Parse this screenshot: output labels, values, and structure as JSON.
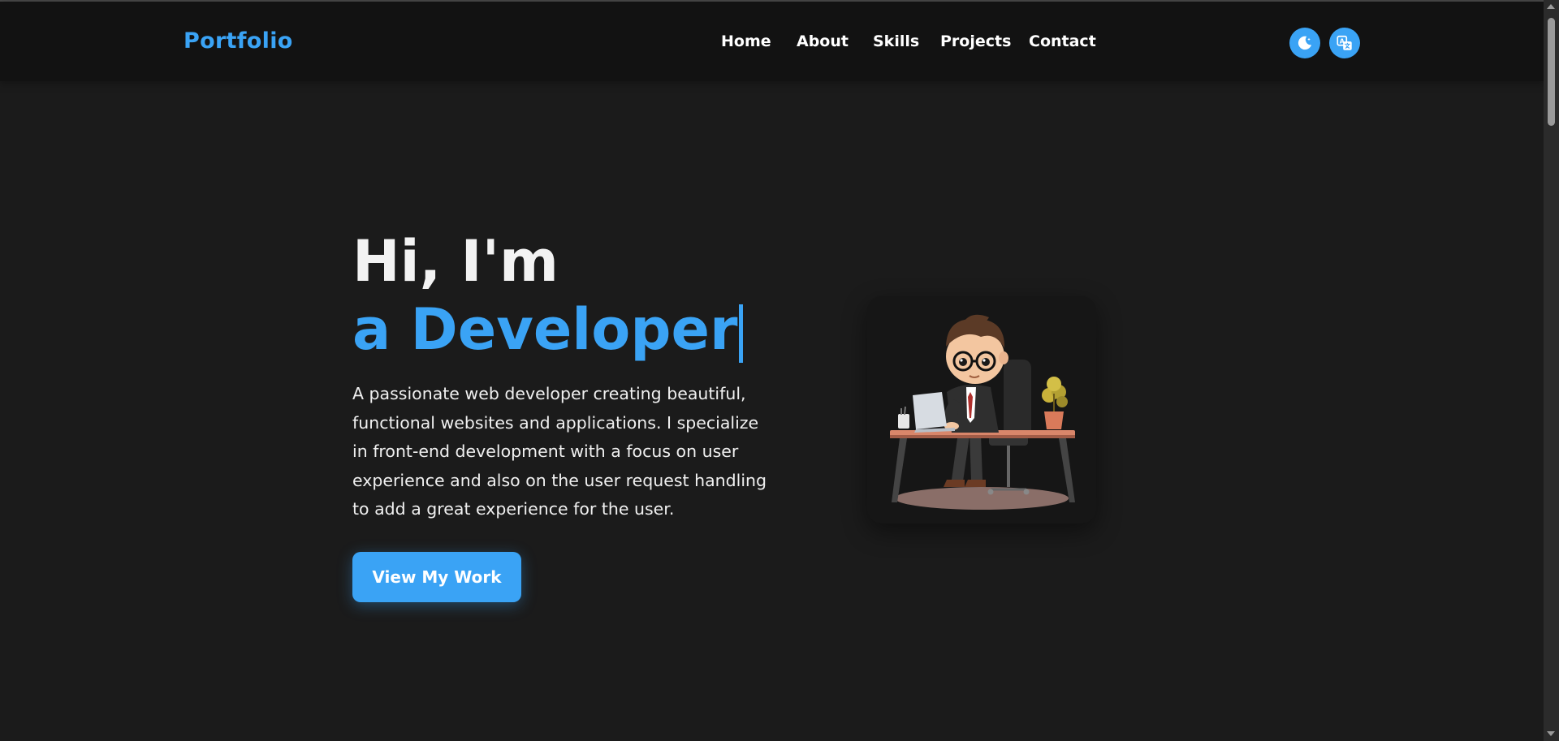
{
  "header": {
    "logo": "Portfolio",
    "nav": [
      "Home",
      "About",
      "Skills",
      "Projects",
      "Contact"
    ],
    "theme_toggle_icon": "moon-icon",
    "language_toggle_icon": "translate-icon"
  },
  "hero": {
    "greeting": "Hi, I'm",
    "role": "a Developer",
    "description": "A passionate web developer creating beautiful, functional websites and applications. I specialize in front-end development with a focus on user experience and also on the user request handling to add a great experience for the user.",
    "cta_label": "View My Work",
    "illustration": "developer-at-desk-illustration"
  },
  "colors": {
    "accent": "#3aa3f5",
    "background": "#1b1b1b",
    "header_background": "#121212"
  }
}
